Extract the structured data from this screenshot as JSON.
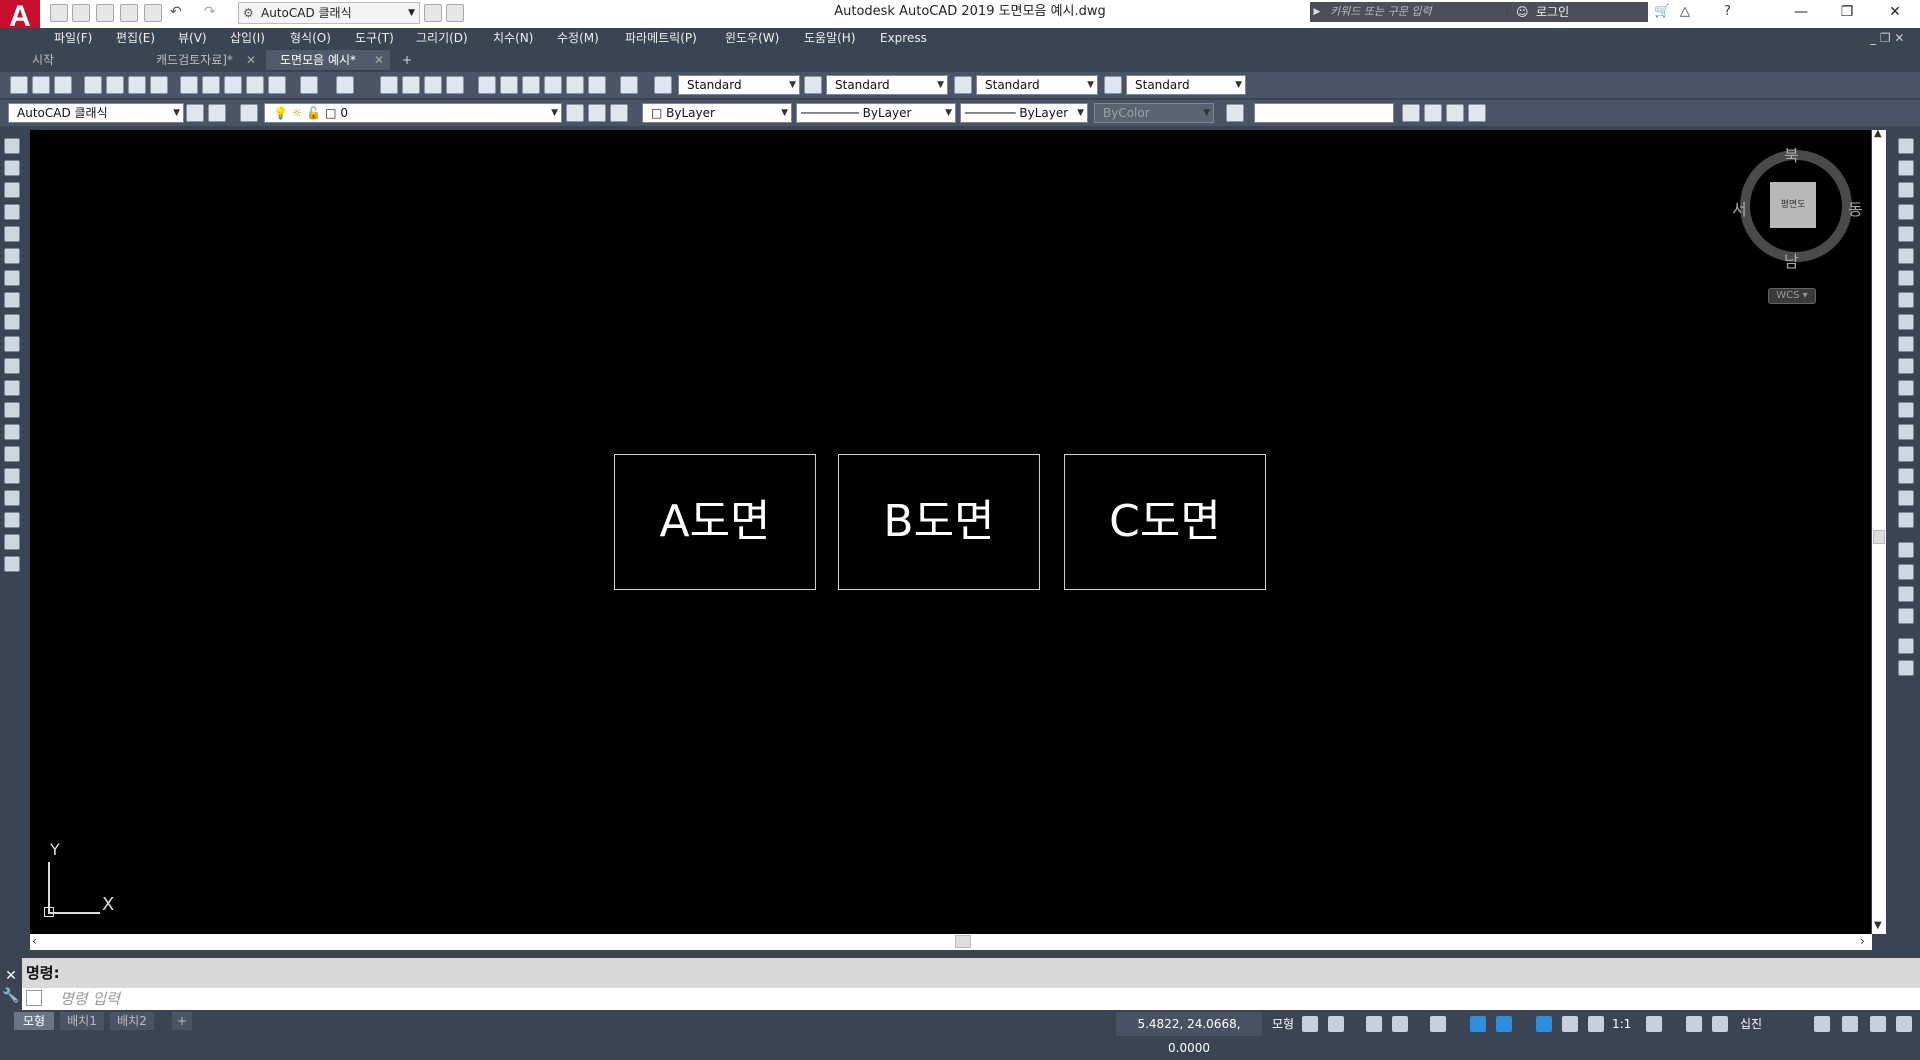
{
  "app": {
    "window_title": "Autodesk AutoCAD 2019    도면모음 예시.dwg",
    "workspace": "AutoCAD 클래식",
    "search_placeholder": "키워드 또는 구문 입력",
    "signin_label": "로그인"
  },
  "menu": [
    "파일(F)",
    "편집(E)",
    "뷰(V)",
    "삽입(I)",
    "형식(O)",
    "도구(T)",
    "그리기(D)",
    "치수(N)",
    "수정(M)",
    "파라메트릭(P)",
    "윈도우(W)",
    "도움말(H)",
    "Express"
  ],
  "tabs": [
    {
      "label": "시작",
      "closable": false
    },
    {
      "label": "캐드검토자료]*",
      "closable": true
    },
    {
      "label": "도면모음 예시*",
      "closable": true,
      "active": true
    }
  ],
  "styles_toolbar": {
    "text_style": "Standard",
    "dim_style": "Standard",
    "table_style": "Standard",
    "mleader_style": "Standard"
  },
  "properties_toolbar": {
    "workspace": "AutoCAD 클래식",
    "layer": "0",
    "color": "ByLayer",
    "linetype": "ByLayer",
    "lineweight": "ByLayer",
    "plot_style": "ByColor"
  },
  "drawing": {
    "boxes": [
      {
        "label": "A도면"
      },
      {
        "label": "B도면"
      },
      {
        "label": "C도면"
      }
    ]
  },
  "viewcube": {
    "face": "평면도",
    "north": "북",
    "south": "남",
    "east": "동",
    "west": "서",
    "wcs": "WCS"
  },
  "ucs": {
    "x": "X",
    "y": "Y"
  },
  "command": {
    "history": "명령:",
    "placeholder": "명령 입력"
  },
  "layout_tabs": [
    "모형",
    "배치1",
    "배치2"
  ],
  "status": {
    "coordinates": "5.4822, 24.0668, 0.0000",
    "model_label": "모형",
    "annotation_scale": "1:1",
    "units": "십진"
  },
  "colors": {
    "canvas": "#000000",
    "chrome": "#3b4453",
    "toolbar": "#4b5466",
    "logo_red": "#c8102e",
    "status_active": "#2f8fdf"
  }
}
